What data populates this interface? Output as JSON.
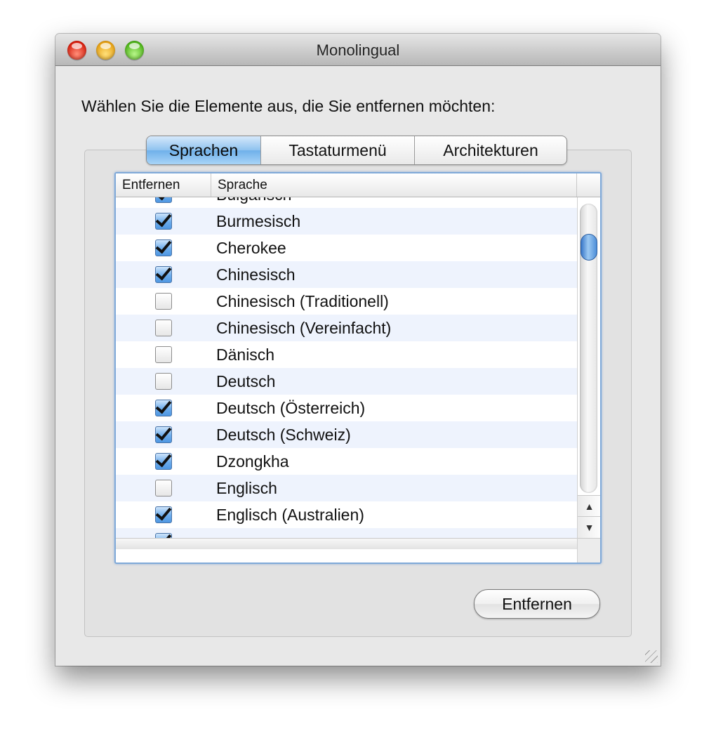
{
  "window": {
    "title": "Monolingual"
  },
  "prompt": "Wählen Sie die Elemente aus, die Sie entfernen möchten:",
  "tabs": [
    {
      "label": "Sprachen",
      "selected": true
    },
    {
      "label": "Tastaturmenü",
      "selected": false
    },
    {
      "label": "Architekturen",
      "selected": false
    }
  ],
  "table": {
    "columns": [
      "Entfernen",
      "Sprache"
    ],
    "rows": [
      {
        "checked": true,
        "language": "Bulgarisch"
      },
      {
        "checked": true,
        "language": "Burmesisch"
      },
      {
        "checked": true,
        "language": "Cherokee"
      },
      {
        "checked": true,
        "language": "Chinesisch"
      },
      {
        "checked": false,
        "language": "Chinesisch (Traditionell)"
      },
      {
        "checked": false,
        "language": "Chinesisch (Vereinfacht)"
      },
      {
        "checked": false,
        "language": "Dänisch"
      },
      {
        "checked": false,
        "language": "Deutsch"
      },
      {
        "checked": true,
        "language": "Deutsch (Österreich)"
      },
      {
        "checked": true,
        "language": "Deutsch (Schweiz)"
      },
      {
        "checked": true,
        "language": "Dzongkha"
      },
      {
        "checked": false,
        "language": "Englisch"
      },
      {
        "checked": true,
        "language": "Englisch (Australien)"
      },
      {
        "checked": true,
        "language": ""
      }
    ]
  },
  "scrollbar": {
    "up_arrow": "▲",
    "down_arrow": "▼"
  },
  "remove_button": {
    "label": "Entfernen"
  },
  "colors": {
    "selection_blue": "#6fb0ea",
    "alt_row": "#eef3fd",
    "focus_ring": "#7fa9d8"
  }
}
